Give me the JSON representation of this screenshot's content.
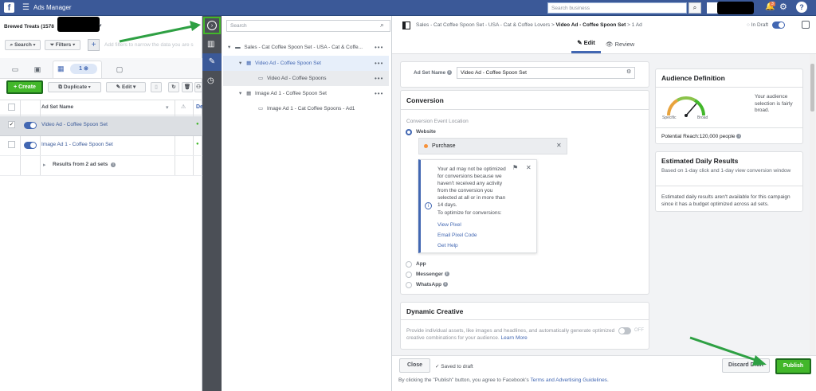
{
  "topbar": {
    "logo": "f",
    "app_title": "Ads Manager",
    "search_placeholder": "Search business",
    "notification_count": "3"
  },
  "left": {
    "account_name": "Brewed Treats (1578",
    "search_label": "Search",
    "filters_label": "Filters",
    "add_label": "+",
    "filter_hint": "Add filters to narrow the data you are s",
    "ads_tab_count": "1",
    "create_label": "Create",
    "duplicate_label": "Duplicate",
    "edit_label": "Edit",
    "column_name": "Ad Set Name",
    "column_delivery": "De",
    "rows": [
      {
        "name": "Video Ad - Coffee Spoon Set",
        "checked": "✓"
      },
      {
        "name": "Image Ad 1 - Coffee Spoon Set",
        "checked": ""
      },
      {
        "name": "Results from 2 ad sets"
      }
    ]
  },
  "tree": {
    "search_placeholder": "Search",
    "items": [
      {
        "label": "Sales - Cat Coffee Spoon Set - USA - Cat & Coffe..."
      },
      {
        "label": "Video Ad - Coffee Spoon Set"
      },
      {
        "label": "Video Ad - Coffee Spoons"
      },
      {
        "label": "Image Ad 1 - Coffee Spoon Set"
      },
      {
        "label": "Image Ad 1 - Cat Coffee Spoons - Ad1"
      }
    ]
  },
  "editor": {
    "breadcrumb_campaign": "Sales - Cat Coffee Spoon Set - USA - Cat & Coffee Lovers",
    "breadcrumb_adset": "Video Ad - Coffee Spoon Set",
    "breadcrumb_ad": "1 Ad",
    "in_draft": "In Draft",
    "tab_edit": "Edit",
    "tab_review": "Review",
    "adset_name_label": "Ad Set Name",
    "adset_name_value": "Video Ad - Coffee Spoon Set",
    "conversion": {
      "title": "Conversion",
      "location_label": "Conversion Event Location",
      "website": "Website",
      "event": "Purchase",
      "warning": "Your ad may not be optimized for conversions because we haven't received any activity from the conversion you selected at all or in more than 14 days.",
      "fix_label": "To optimize for conversions:",
      "links": [
        "View Pixel",
        "Email Pixel Code",
        "Get Help"
      ],
      "app": "App",
      "messenger": "Messenger",
      "whatsapp": "WhatsApp"
    },
    "dynamic": {
      "title": "Dynamic Creative",
      "description": "Provide individual assets, like images and headlines, and automatically generate optimized creative combinations for your audience.",
      "learn_more": "Learn More",
      "toggle_state": "OFF"
    },
    "audience": {
      "title": "Audience Definition",
      "specific": "Specific",
      "broad": "Broad",
      "description": "Your audience selection is fairly broad.",
      "potential_reach": "Potential Reach:120,000 people"
    },
    "estimated": {
      "title": "Estimated Daily Results",
      "subtitle": "Based on 1-day click and 1-day view conversion window",
      "note": "Estimated daily results aren't available for this campaign since it has a budget optimized across ad sets."
    },
    "footer": {
      "close": "Close",
      "saved": "Saved to draft",
      "discard": "Discard Draft",
      "publish": "Publish",
      "terms_prefix": "By clicking the \"Publish\" button, you agree to Facebook's",
      "terms_link": "Terms and Advertising Guidelines",
      "terms_suffix": "."
    }
  },
  "colors": {
    "brand": "#3b5998",
    "accent": "#4267b2",
    "green": "#42b72a",
    "arrow_green": "#2ea043"
  }
}
